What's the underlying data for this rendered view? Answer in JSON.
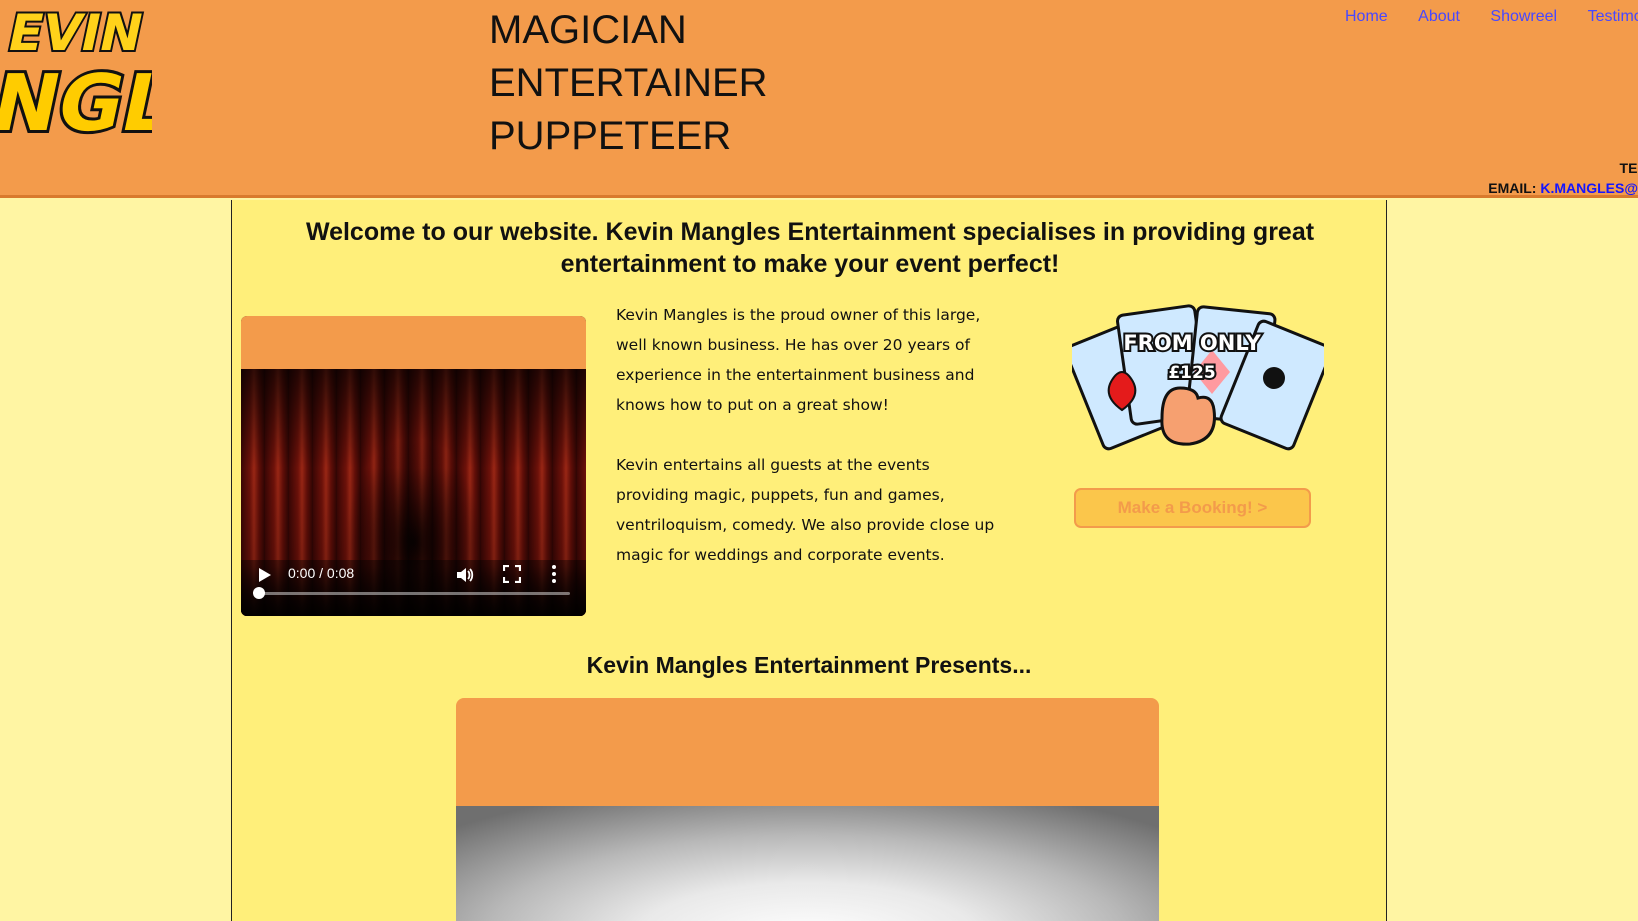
{
  "header": {
    "logo_text": "KEVIN MANGLES",
    "tagline": [
      "MAGICIAN",
      "ENTERTAINER",
      "PUPPETEER"
    ],
    "nav": [
      "Home",
      "About",
      "Showreel",
      "Testimon"
    ],
    "contact": {
      "tel_label": "TEL",
      "email_label": "EMAIL:",
      "email_value": "K.MANGLES@"
    }
  },
  "main": {
    "welcome": "Welcome to our website. Kevin Mangles Entertainment specialises in providing great entertainment to make your event perfect!",
    "video": {
      "time": "0:00 / 0:08",
      "progress": 0.0
    },
    "about": [
      "Kevin Mangles is the proud owner of this large, well known business. He has over 20 years of experience in the entertainment business and knows how to put on a great show!",
      "Kevin entertains all guests at the events providing magic, puppets, fun and games, ventriloquism, comedy. We also provide close up magic for weddings and corporate events."
    ],
    "promo": {
      "line1": "FROM ONLY",
      "price": "£125"
    },
    "booking_button": "Make a Booking! >",
    "presents_heading": "Kevin Mangles Entertainment Presents..."
  },
  "colors": {
    "header_bg": "#f39b4b",
    "page_bg": "#fff5a3",
    "panel_bg": "#ffef7a",
    "nav_link": "#4848ff"
  }
}
